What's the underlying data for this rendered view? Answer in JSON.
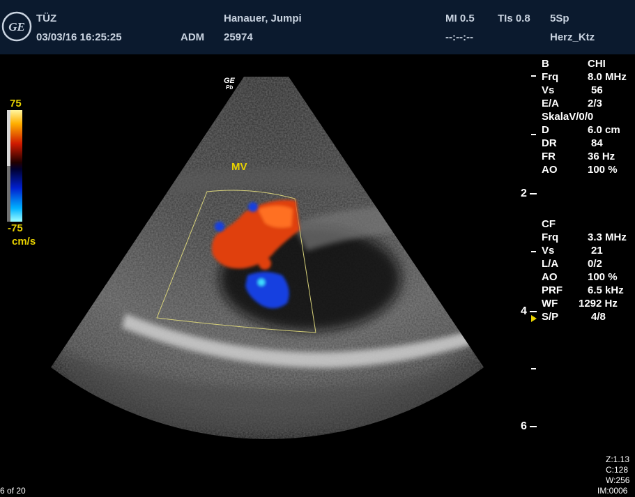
{
  "header": {
    "site": "TÜZ",
    "datetime": "03/03/16 16:25:25",
    "operator": "ADM",
    "patient_name": "Hanauer, Jumpi",
    "patient_id": "25974",
    "mi": "MI 0.5",
    "tis": "TIs 0.8",
    "probe": "5Sp",
    "preset": "Herz_Ktz",
    "time_placeholder": "--:--:--"
  },
  "logo": {
    "name": "ge-logo-icon",
    "text": "GE"
  },
  "image": {
    "probe_mark_top": "GE",
    "probe_mark_bottom": "Pb",
    "label_mv": "MV"
  },
  "color_bar": {
    "max": "75",
    "min": "-75",
    "unit": "cm/s"
  },
  "bmode_params": {
    "rows": [
      {
        "k": "B",
        "v": "CHI"
      },
      {
        "k": "Frq",
        "v": "8.0 MHz"
      },
      {
        "k": "Vs",
        "v": "56"
      },
      {
        "k": "E/A",
        "v": "2/3"
      },
      {
        "k": "SkalaV/0/0",
        "v": ""
      },
      {
        "k": "D",
        "v": "6.0 cm"
      },
      {
        "k": "DR",
        "v": "84"
      },
      {
        "k": "FR",
        "v": "36 Hz"
      },
      {
        "k": "AO",
        "v": "100 %"
      }
    ]
  },
  "cf_params": {
    "rows": [
      {
        "k": "CF",
        "v": ""
      },
      {
        "k": "Frq",
        "v": "3.3 MHz"
      },
      {
        "k": "Vs",
        "v": "21"
      },
      {
        "k": "L/A",
        "v": "0/2"
      },
      {
        "k": "AO",
        "v": "100 %"
      },
      {
        "k": "PRF",
        "v": "6.5 kHz"
      },
      {
        "k": "WF",
        "v": "1292 Hz"
      },
      {
        "k": "S/P",
        "v": "4/8"
      }
    ]
  },
  "depth_scale": {
    "labels": [
      "2",
      "4",
      "6"
    ]
  },
  "footer": {
    "frame": "6 of 20",
    "zoom": "Z:1.13",
    "contrast": "C:128",
    "width": "W:256",
    "image_num": "IM:0006"
  },
  "colors": {
    "header_bg": "#0b1a2e",
    "accent_yellow": "#e8d200",
    "flow_red": "#e0400f",
    "flow_blue": "#1540e0"
  }
}
